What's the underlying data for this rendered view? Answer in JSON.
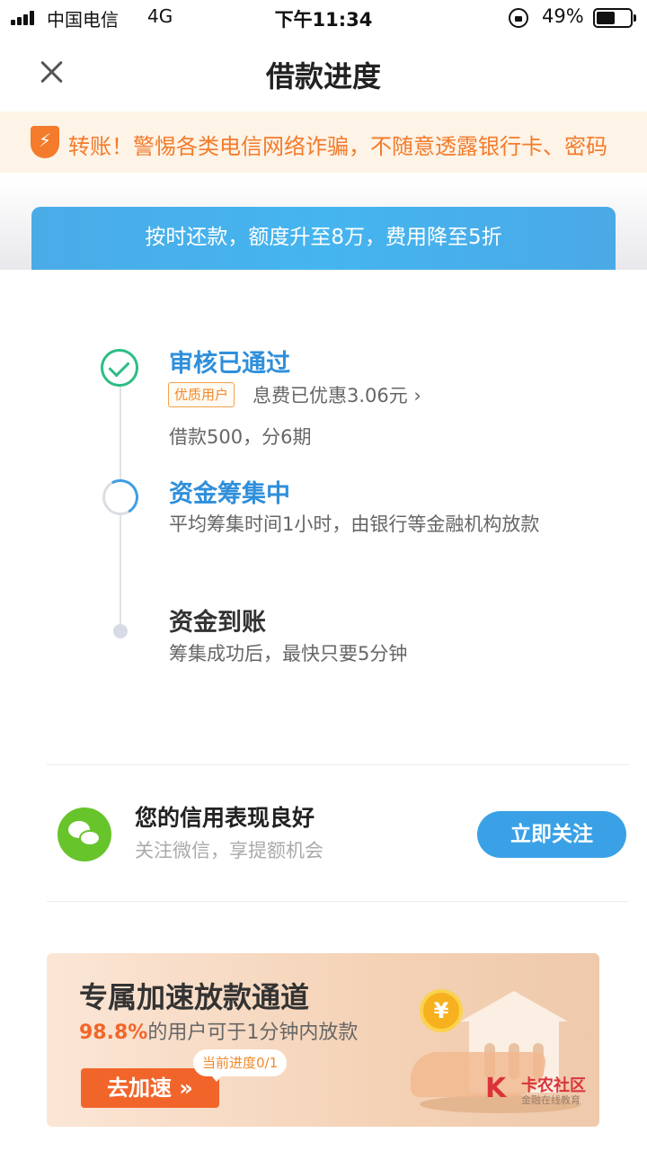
{
  "status_bar": {
    "carrier": "中国电信",
    "network": "4G",
    "time": "下午11:34",
    "battery": "49%"
  },
  "nav": {
    "title": "借款进度"
  },
  "warning": {
    "text": "转账！警惕各类电信网络诈骗，不随意透露银行卡、密码"
  },
  "promo": {
    "text": "按时还款，额度升至8万，费用降至5折"
  },
  "steps": [
    {
      "title": "审核已通过",
      "badge": "优质用户",
      "discount": "息费已优惠3.06元 ›",
      "sub": "借款500，分6期"
    },
    {
      "title": "资金筹集中",
      "sub": "平均筹集时间1小时，由银行等金融机构放款"
    },
    {
      "title": "资金到账",
      "sub": "筹集成功后，最快只要5分钟"
    }
  ],
  "credit": {
    "title": "您的信用表现良好",
    "sub": "关注微信，享提额机会",
    "button": "立即关注"
  },
  "accelerate": {
    "title": "专属加速放款通道",
    "highlight": "98.8%",
    "sub_rest": "的用户可于1分钟内放款",
    "button": "去加速 »",
    "progress_tip": "当前进度0/1",
    "coin": "¥"
  },
  "watermark": {
    "mark": "K",
    "name": "卡农社区",
    "tagline": "金融在线教育"
  },
  "colors": {
    "accent_blue": "#3aa1e6",
    "success_green": "#2ebd85",
    "warning_orange": "#f37b2b",
    "cta_orange": "#f2652a"
  }
}
